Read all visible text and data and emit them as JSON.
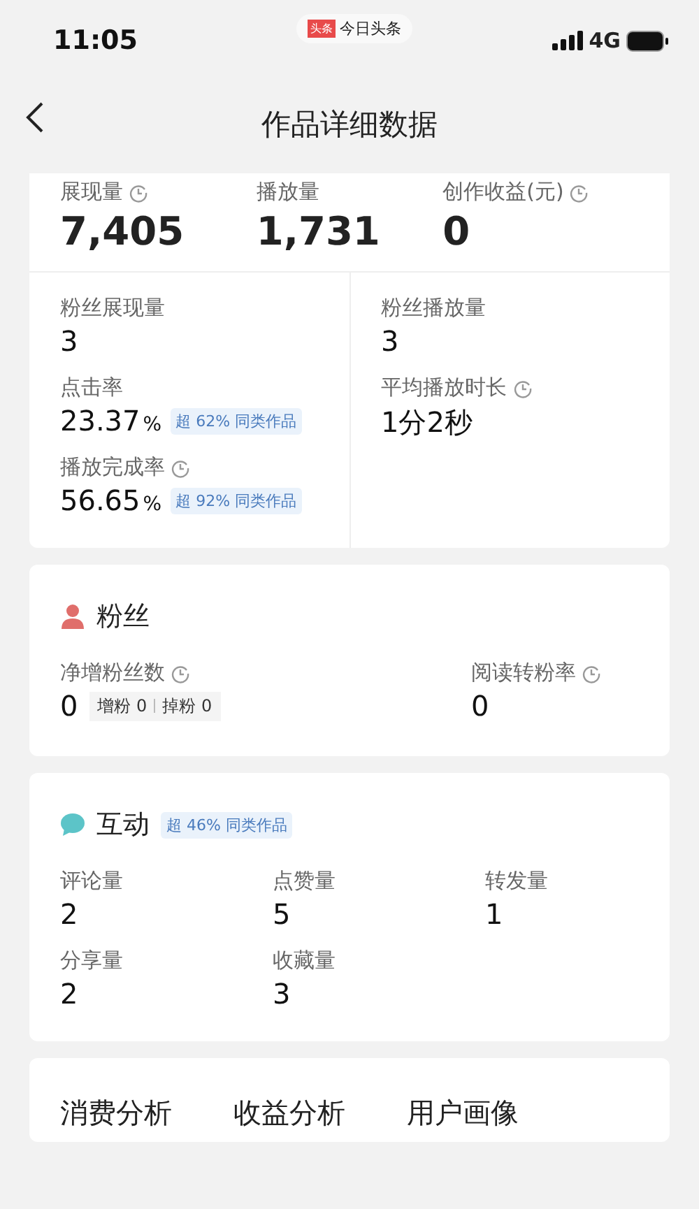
{
  "status_bar": {
    "time": "11:05",
    "app_logo": "头条",
    "app_name": "今日头条",
    "network": "4G"
  },
  "nav": {
    "title": "作品详细数据"
  },
  "overview": {
    "metrics": [
      {
        "label": "展现量",
        "value": "7,405",
        "info": true
      },
      {
        "label": "播放量",
        "value": "1,731",
        "info": false
      },
      {
        "label": "创作收益(元)",
        "value": "0",
        "info": true
      }
    ],
    "columns": [
      [
        {
          "label": "粉丝展现量",
          "value": "3",
          "info": false
        },
        {
          "label": "点击率",
          "value": "23.37",
          "unit": "%",
          "info": false,
          "badge": "超 62% 同类作品"
        },
        {
          "label": "播放完成率",
          "value": "56.65",
          "unit": "%",
          "info": true,
          "badge": "超 92% 同类作品"
        }
      ],
      [
        {
          "label": "粉丝播放量",
          "value": "3",
          "info": false
        },
        {
          "label": "平均播放时长",
          "value": "1分2秒",
          "info": true
        }
      ]
    ]
  },
  "fans": {
    "title": "粉丝",
    "metrics": [
      {
        "label": "净增粉丝数",
        "value": "0",
        "info": true,
        "gained": "增粉 0",
        "lost": "掉粉 0"
      },
      {
        "label": "阅读转粉率",
        "value": "0",
        "info": true
      }
    ]
  },
  "interaction": {
    "title": "互动",
    "badge": "超 46% 同类作品",
    "metrics": [
      {
        "label": "评论量",
        "value": "2"
      },
      {
        "label": "点赞量",
        "value": "5"
      },
      {
        "label": "转发量",
        "value": "1"
      },
      {
        "label": "分享量",
        "value": "2"
      },
      {
        "label": "收藏量",
        "value": "3"
      }
    ]
  },
  "tabs": [
    "消费分析",
    "收益分析",
    "用户画像"
  ]
}
